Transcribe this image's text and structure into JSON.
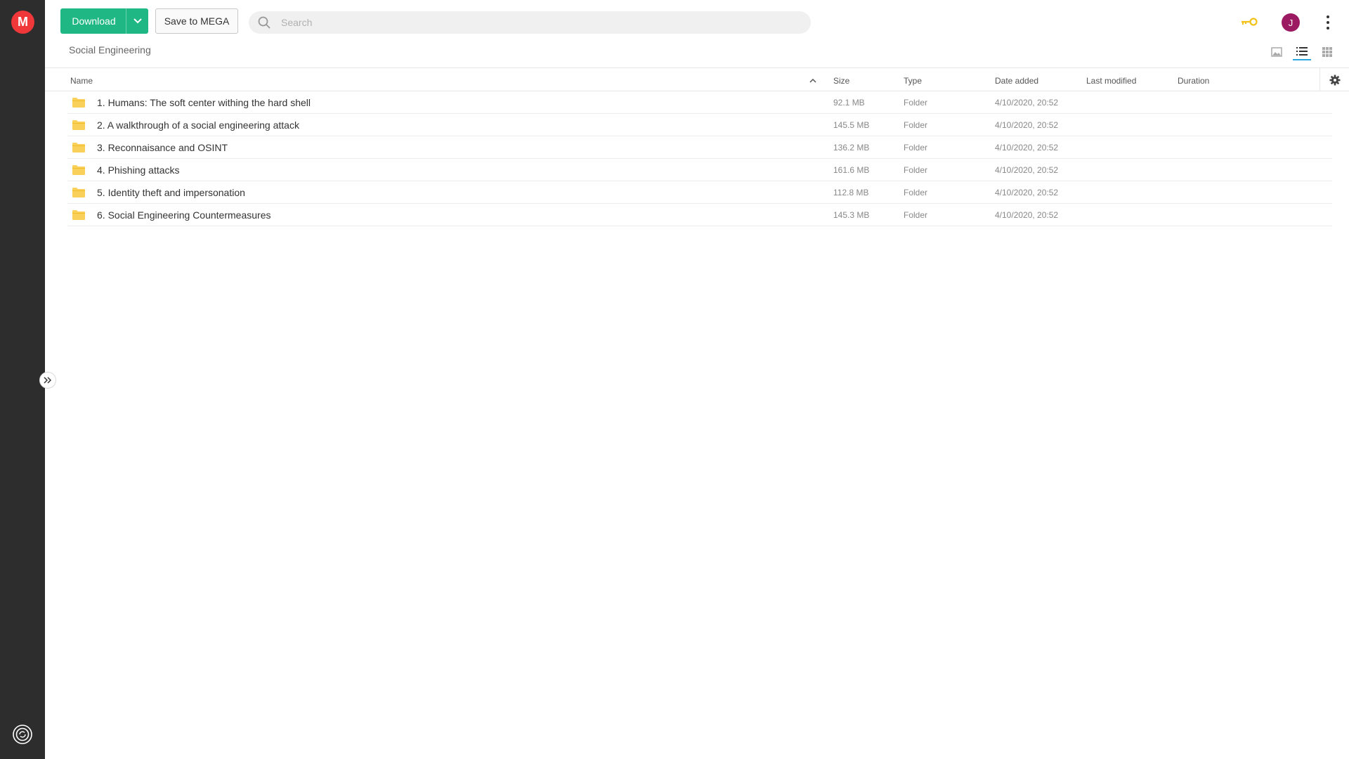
{
  "app": {
    "logo_letter": "M"
  },
  "toolbar": {
    "download_label": "Download",
    "save_label": "Save to MEGA",
    "search_placeholder": "Search",
    "search_value": ""
  },
  "user": {
    "avatar_initial": "J"
  },
  "breadcrumb": {
    "current": "Social Engineering"
  },
  "columns": {
    "name": "Name",
    "size": "Size",
    "type": "Type",
    "date_added": "Date added",
    "last_modified": "Last modified",
    "duration": "Duration"
  },
  "rows": [
    {
      "name": "1. Humans: The soft center withing the hard shell",
      "size": "92.1 MB",
      "type": "Folder",
      "date_added": "4/10/2020, 20:52",
      "last_modified": "",
      "duration": ""
    },
    {
      "name": "2. A walkthrough of a social engineering attack",
      "size": "145.5 MB",
      "type": "Folder",
      "date_added": "4/10/2020, 20:52",
      "last_modified": "",
      "duration": ""
    },
    {
      "name": "3. Reconnaisance and OSINT",
      "size": "136.2 MB",
      "type": "Folder",
      "date_added": "4/10/2020, 20:52",
      "last_modified": "",
      "duration": ""
    },
    {
      "name": "4. Phishing attacks",
      "size": "161.6 MB",
      "type": "Folder",
      "date_added": "4/10/2020, 20:52",
      "last_modified": "",
      "duration": ""
    },
    {
      "name": "5. Identity theft and impersonation",
      "size": "112.8 MB",
      "type": "Folder",
      "date_added": "4/10/2020, 20:52",
      "last_modified": "",
      "duration": ""
    },
    {
      "name": "6. Social Engineering Countermeasures",
      "size": "145.3 MB",
      "type": "Folder",
      "date_added": "4/10/2020, 20:52",
      "last_modified": "",
      "duration": ""
    }
  ],
  "colors": {
    "sidebar": "#2d2d2d",
    "brand": "#f0373a",
    "download": "#1fb783",
    "avatar": "#9b1a61",
    "key": "#f2c21b",
    "folder": "#f9d15a",
    "active_view": "#2ba6de"
  },
  "icons": [
    "mega-logo-icon",
    "chevron-down-icon",
    "search-icon",
    "key-icon",
    "more-vertical-icon",
    "thumbnail-view-icon",
    "list-view-icon",
    "grid-view-icon",
    "sort-up-icon",
    "settings-gear-icon",
    "folder-icon",
    "expand-sidebar-icon",
    "sync-icon"
  ]
}
